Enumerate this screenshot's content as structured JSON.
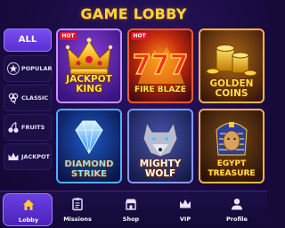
{
  "header": {
    "title": "GAME LOBBY"
  },
  "sidebar": {
    "items": [
      {
        "label": "ALL",
        "icon": "all"
      },
      {
        "label": "POPULAR",
        "icon": "star-icon"
      },
      {
        "label": "CLASSIC",
        "icon": "clover-icon"
      },
      {
        "label": "FRUITS",
        "icon": "cherries-icon"
      },
      {
        "label": "JACKPOT",
        "icon": "crown-icon"
      }
    ]
  },
  "games": [
    {
      "name_line1": "JACKPOT",
      "name_line2": "KING",
      "badge": "HOT",
      "icon": "crown-icon"
    },
    {
      "name_line1": "FIRE BLAZE",
      "name_line2": "",
      "badge": "HOT",
      "icon": "triple-seven-icon"
    },
    {
      "name_line1": "GOLDEN",
      "name_line2": "COINS",
      "badge": "",
      "icon": "gold-coins-icon"
    },
    {
      "name_line1": "DIAMOND",
      "name_line2": "STRIKE",
      "badge": "",
      "icon": "diamond-icon"
    },
    {
      "name_line1": "MIGHTY",
      "name_line2": "WOLF",
      "badge": "",
      "icon": "wolf-icon"
    },
    {
      "name_line1": "EGYPT",
      "name_line2": "TREASURE",
      "badge": "",
      "icon": "pharaoh-icon"
    }
  ],
  "nav": {
    "items": [
      {
        "label": "Lobby",
        "icon": "home-icon",
        "active": true
      },
      {
        "label": "Missions",
        "icon": "clipboard-icon",
        "active": false
      },
      {
        "label": "Shop",
        "icon": "shop-icon",
        "active": false
      },
      {
        "label": "VIP",
        "icon": "crown-icon",
        "active": false
      },
      {
        "label": "Profile",
        "icon": "user-icon",
        "active": false
      }
    ]
  },
  "colors": {
    "background": "#1a0b42",
    "accent_gold": "#ffd23f",
    "active_purple": "#6a3fe0",
    "hot_red": "#e3142a"
  }
}
